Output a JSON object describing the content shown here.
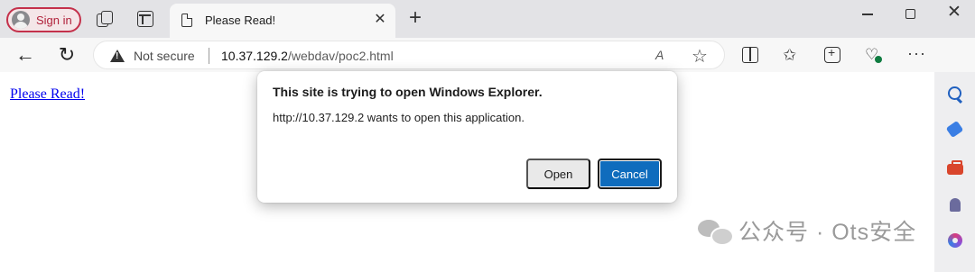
{
  "tabstrip": {
    "signin_label": "Sign in",
    "tab_title": "Please Read!",
    "tab_close_glyph": "✕",
    "newtab_glyph": "+",
    "close_window_glyph": "✕"
  },
  "toolbar": {
    "back_glyph": "←",
    "reload_glyph": "↻",
    "security_label": "Not secure",
    "url_host": "10.37.129.2",
    "url_path": "/webdav/poc2.html",
    "read_aloud_glyph": "A",
    "favorite_glyph": "☆",
    "favorites_glyph": "✩",
    "health_glyph": "♡",
    "more_glyph": "···"
  },
  "page": {
    "link_text": "Please Read!"
  },
  "dialog": {
    "title": "This site is trying to open Windows Explorer.",
    "message": "http://10.37.129.2 wants to open this application.",
    "open_label": "Open",
    "cancel_label": "Cancel"
  },
  "watermark": {
    "text": "公众号 · Ots安全"
  },
  "colors": {
    "signin_accent": "#c4314b",
    "link": "#0000ee",
    "primary_button": "#0f6cbd"
  }
}
